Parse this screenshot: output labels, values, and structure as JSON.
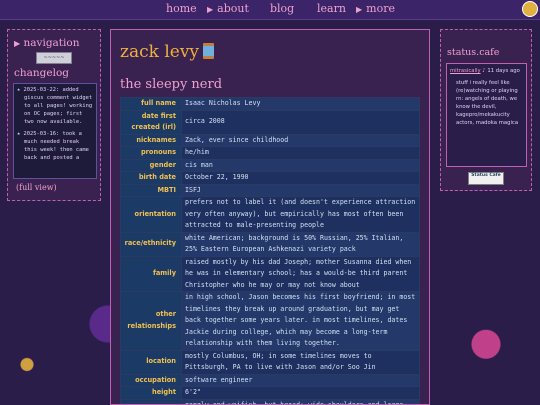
{
  "nav": {
    "items": [
      {
        "label": "home",
        "arrow": false
      },
      {
        "label": "about",
        "arrow": true
      },
      {
        "label": "blog",
        "arrow": false
      },
      {
        "label": "learn",
        "arrow": false
      },
      {
        "label": "more",
        "arrow": true
      }
    ],
    "arrow_glyph": "▶"
  },
  "sidebar": {
    "navigation_heading": "navigation",
    "nav_button_label": "~~~~~",
    "changelog_heading": "changelog",
    "changelog": [
      "2025-03-22: added giscus comment widget to all pages! working on OC pages; first two now available.",
      "2025-03-16: took a much needed break this week! then came back and posted a"
    ],
    "full_view_label": "(full view)"
  },
  "main": {
    "title": "zack levy",
    "subtitle": "the sleepy nerd",
    "rows": [
      {
        "key": "full name",
        "value": "Isaac Nicholas Levy"
      },
      {
        "key": "date first created (irl)",
        "value": "circa 2008"
      },
      {
        "key": "nicknames",
        "value": "Zack, ever since childhood"
      },
      {
        "key": "pronouns",
        "value": "he/him"
      },
      {
        "key": "gender",
        "value": "cis man"
      },
      {
        "key": "birth date",
        "value": "October 22, 1990"
      },
      {
        "key": "MBTI",
        "value": "ISFJ"
      },
      {
        "key": "orientation",
        "value": "prefers not to label it (and doesn't experience attraction very often anyway), but empirically has most often been attracted to male-presenting people"
      },
      {
        "key": "race/ethnicity",
        "value": "white American; background is 50% Russian, 25% Italian, 25% Eastern European Ashkenazi variety pack"
      },
      {
        "key": "family",
        "value": "raised mostly by his dad Joseph; mother Susanna died when he was in elementary school; has a would-be third parent Christopher who he may or may not know about"
      },
      {
        "key": "other relationships",
        "value": "in high school, Jason becomes his first boyfriend; in most timelines they break up around graduation, but may get back together some years later. in most timelines, dates Jackie during college, which may become a long-term relationship with them living together."
      },
      {
        "key": "location",
        "value": "mostly Columbus, OH; in some timelines moves to Pittsburgh, PA to live with Jason and/or Soo Jin"
      },
      {
        "key": "occupation",
        "value": "software engineer"
      },
      {
        "key": "height",
        "value": "6'2\""
      },
      {
        "key": "build",
        "value": "gangly and waifish, but broad; wide shoulders and large hands"
      }
    ]
  },
  "status": {
    "heading": "status.cafe",
    "user": "mitrasically",
    "time": "11 days ago",
    "text": "stuff i really feel like (re)watching or playing rn: angels of death, we know the devil, kagepro/mekakucity actors, madoka magica",
    "badge_label": "Status Cafe"
  },
  "colors": {
    "accent_pink": "#f0a0d0",
    "title_gold": "#f0b040",
    "key_gold": "#f0c050",
    "panel_bg": "#3a2250",
    "table_bg": "#24386a"
  }
}
